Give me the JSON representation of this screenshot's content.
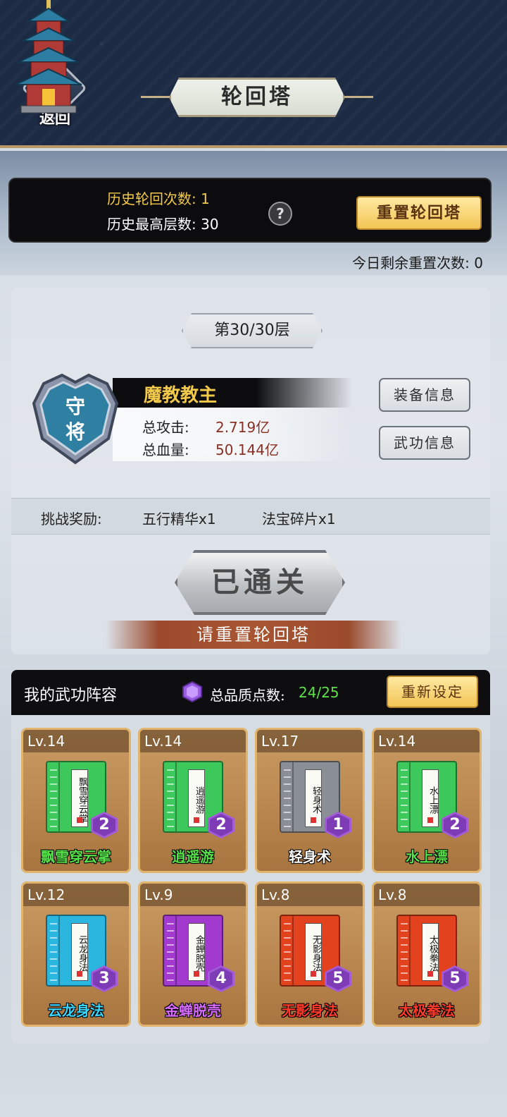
{
  "header": {
    "back_label": "返回",
    "title": "轮回塔"
  },
  "banner": {
    "history_count_label": "历史轮回次数: 1",
    "history_max_label": "历史最高层数: 30",
    "help_symbol": "?",
    "reset_tower_label": "重置轮回塔",
    "remaining_resets": "今日剩余重置次数: 0"
  },
  "boss": {
    "floor": "第30/30层",
    "shield_text": "守将",
    "name": "魔教教主",
    "attack_label": "总攻击:",
    "attack_value": "2.719亿",
    "hp_label": "总血量:",
    "hp_value": "50.144亿",
    "equip_info_label": "装备信息",
    "skill_info_label": "武功信息"
  },
  "reward": {
    "label": "挑战奖励:",
    "items": [
      "五行精华x1",
      "法宝碎片x1"
    ]
  },
  "status": {
    "cleared_label": "已通关",
    "hint": "请重置轮回塔"
  },
  "skills": {
    "title": "我的武功阵容",
    "quality_label": "总品质点数:",
    "quality_value": "24/25",
    "reset_label": "重新设定",
    "cards": [
      {
        "level": "Lv.14",
        "name": "飘雪穿云掌",
        "book_text": "飘雪穿云掌",
        "grade": "2",
        "color": "#3cc85a",
        "name_color": "#55e04a"
      },
      {
        "level": "Lv.14",
        "name": "逍遥游",
        "book_text": "逍遥游",
        "grade": "2",
        "color": "#3cc85a",
        "name_color": "#55e04a"
      },
      {
        "level": "Lv.17",
        "name": "轻身术",
        "book_text": "轻身术",
        "grade": "1",
        "color": "#8a8f96",
        "name_color": "#ffffff"
      },
      {
        "level": "Lv.14",
        "name": "水上漂",
        "book_text": "水上漂",
        "grade": "2",
        "color": "#3cc85a",
        "name_color": "#55e04a"
      },
      {
        "level": "Lv.12",
        "name": "云龙身法",
        "book_text": "云龙身法",
        "grade": "3",
        "color": "#2bb6e0",
        "name_color": "#3ad6ff"
      },
      {
        "level": "Lv.9",
        "name": "金蝉脱壳",
        "book_text": "金蝉脱壳",
        "grade": "4",
        "color": "#a23ad0",
        "name_color": "#d86bff"
      },
      {
        "level": "Lv.8",
        "name": "无影身法",
        "book_text": "无影身法",
        "grade": "5",
        "color": "#e3421f",
        "name_color": "#ff3a2a"
      },
      {
        "level": "Lv.8",
        "name": "太极拳法",
        "book_text": "太极拳法",
        "grade": "5",
        "color": "#e3421f",
        "name_color": "#ff3a2a"
      }
    ]
  }
}
